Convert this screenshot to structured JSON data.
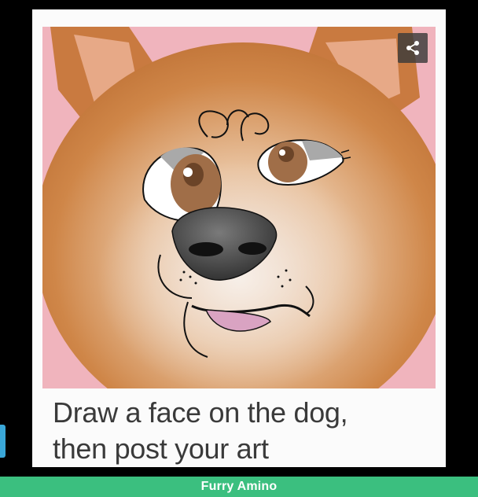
{
  "caption": {
    "line1": "Draw a face on the dog,",
    "line2": "then post your art"
  },
  "footer": {
    "brand": "Furry Amino"
  },
  "icons": {
    "share": "share-icon"
  },
  "colors": {
    "footer_bg": "#3bbf7f",
    "background": "#000000",
    "card": "#fbfbfb",
    "caption_text": "#3a3a3a"
  }
}
